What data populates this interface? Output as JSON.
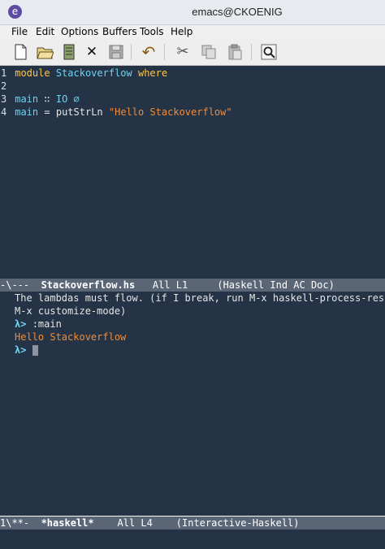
{
  "window": {
    "title": "emacs@CKOENIG",
    "app_icon": "emacs-icon"
  },
  "menu": {
    "items": [
      "File",
      "Edit",
      "Options",
      "Buffers",
      "Tools",
      "Help"
    ]
  },
  "toolbar": {
    "buttons": [
      {
        "name": "new-file-icon"
      },
      {
        "name": "open-folder-icon"
      },
      {
        "name": "dired-icon"
      },
      {
        "name": "close-icon",
        "glyph": "✕"
      },
      {
        "name": "save-icon"
      },
      {
        "name": "undo-icon",
        "glyph": "↶"
      },
      {
        "name": "cut-icon",
        "glyph": "✂"
      },
      {
        "name": "copy-icon"
      },
      {
        "name": "paste-icon"
      },
      {
        "name": "search-icon"
      }
    ]
  },
  "editor": {
    "lines": [
      {
        "num": "1",
        "keyword": "module",
        "name": "Stackoverflow",
        "where": "where"
      },
      {
        "num": "2"
      },
      {
        "num": "3",
        "fn": "main",
        "op": "∷",
        "type": "IO",
        "unit": "∅"
      },
      {
        "num": "4",
        "fn": "main",
        "op": "=",
        "call": "putStrLn",
        "string": "\"Hello Stackoverflow\""
      }
    ]
  },
  "modeline_top": {
    "status": "-\\---",
    "buffer": "Stackoverflow.hs",
    "position": "All L1",
    "mode": "(Haskell Ind AC Doc)"
  },
  "repl": {
    "message1": "The lambdas must flow. (if I break, run M-x haskell-process-res",
    "message2": "M-x customize-mode)",
    "prompt": "λ>",
    "command": ":main",
    "output": "Hello Stackoverflow"
  },
  "modeline_bottom": {
    "status": "1\\**-",
    "buffer": "*haskell*",
    "position": "All L4",
    "mode": "(Interactive-Haskell)"
  },
  "colors": {
    "background": "#243346",
    "keyword": "#ffc547",
    "identifier": "#6fd3ee",
    "string": "#f08c3a",
    "modeline": "#5a6676"
  }
}
